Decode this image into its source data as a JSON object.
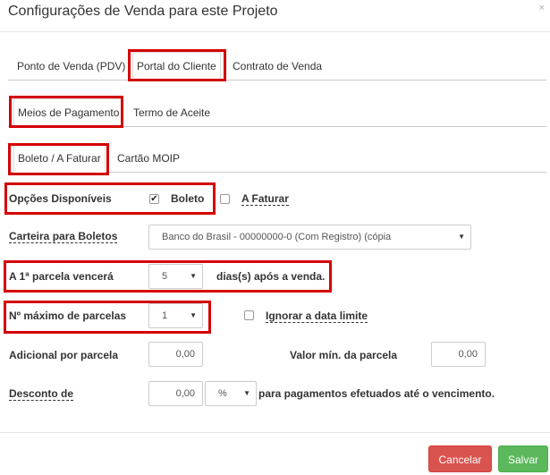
{
  "modal": {
    "title": "Configurações de Venda para este Projeto",
    "close_label": "×"
  },
  "tabs_main": [
    {
      "label": "Ponto de Venda (PDV)"
    },
    {
      "label": "Portal do Cliente"
    },
    {
      "label": "Contrato de Venda"
    }
  ],
  "tabs_sub": [
    {
      "label": "Meios de Pagamento"
    },
    {
      "label": "Termo de Aceite"
    }
  ],
  "tabs_payment": [
    {
      "label": "Boleto / A Faturar"
    },
    {
      "label": "Cartão MOIP"
    }
  ],
  "options": {
    "label": "Opções Disponíveis",
    "boleto_label": "Boleto",
    "boleto_check": "✔",
    "faturar_label": "A Faturar"
  },
  "carteira": {
    "label": "Carteira para Boletos",
    "value": "Banco do Brasil - 00000000-0 (Com Registro) (cópia"
  },
  "primeira_parcela": {
    "label": "A 1ª parcela vencerá",
    "value": "5",
    "suffix": "dias(s) após a venda."
  },
  "max_parcelas": {
    "label": "Nº máximo de parcelas",
    "value": "1",
    "ignore_label": "Ignorar a data limite"
  },
  "adicional": {
    "label": "Adicional por parcela",
    "value": "0,00",
    "min_label": "Valor mín. da parcela",
    "min_value": "0,00"
  },
  "desconto": {
    "label": "Desconto de",
    "value": "0,00",
    "unit": "%",
    "suffix": "para pagamentos efetuados até o vencimento."
  },
  "footer": {
    "cancel_label": "Cancelar",
    "save_label": "Salvar"
  },
  "icons": {
    "caret": "▼"
  },
  "colors": {
    "highlight": "#d40000",
    "cancel": "#d9534f",
    "save": "#5cb85c"
  }
}
